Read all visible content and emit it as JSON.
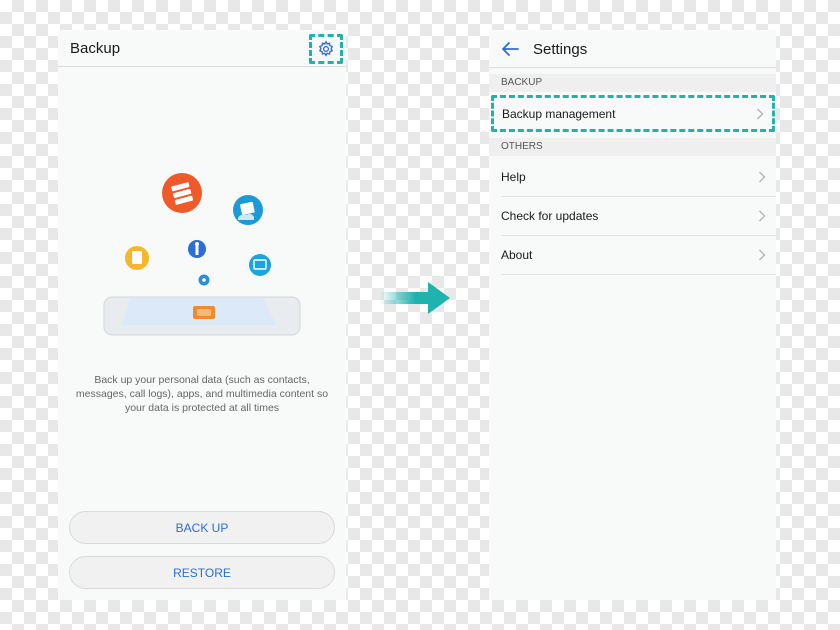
{
  "left_screen": {
    "title": "Backup",
    "description": "Back up your personal data (such as contacts, messages, call logs), apps, and multimedia content so your data is protected at all times",
    "back_up_button": "BACK UP",
    "restore_button": "RESTORE"
  },
  "right_screen": {
    "title": "Settings",
    "sections": [
      {
        "header": "BACKUP",
        "items": [
          "Backup management"
        ]
      },
      {
        "header": "OTHERS",
        "items": [
          "Help",
          "Check for updates",
          "About"
        ]
      }
    ]
  },
  "colors": {
    "accent": "#1fb3b0",
    "link_blue": "#2a6ed6",
    "icon_orange": "#ef5a28",
    "icon_blue": "#1d9ad6",
    "icon_yellow": "#f7b72a"
  },
  "icons": [
    "settings-gear-icon",
    "back-arrow-icon",
    "chevron-right-icon",
    "next-step-arrow-icon"
  ]
}
